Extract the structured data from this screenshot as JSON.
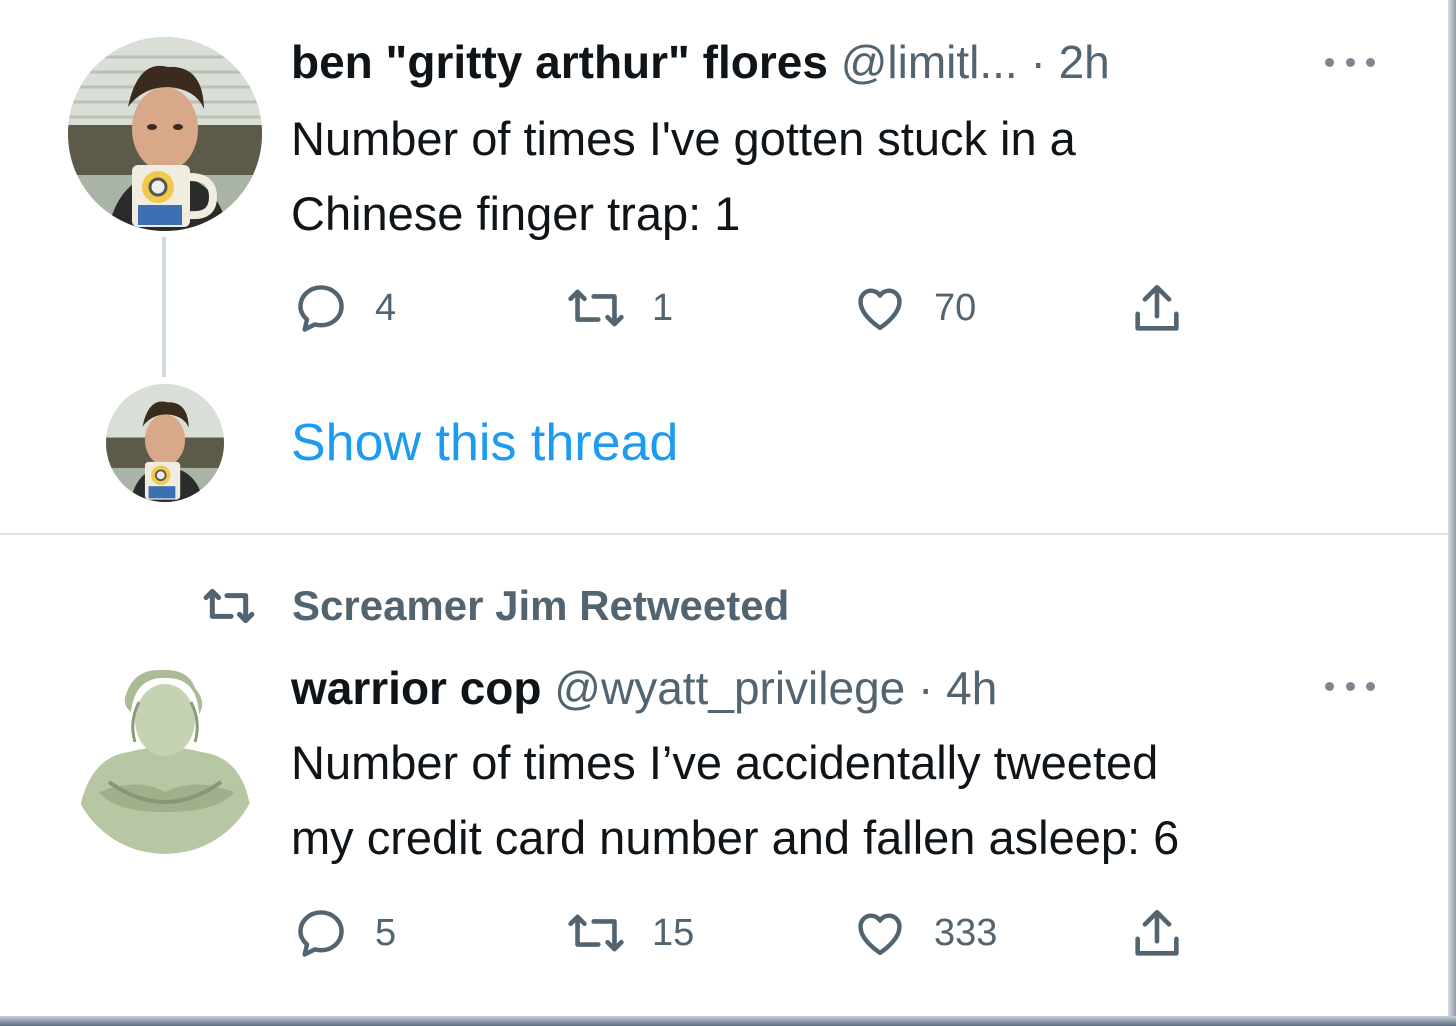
{
  "tweets": [
    {
      "display_name": "ben \"gritty arthur\" flores",
      "handle": "@limitl...",
      "separator": "·",
      "time": "2h",
      "text": "Number of times I've gotten stuck in a\nChinese finger trap: 1",
      "replies": "4",
      "retweets": "1",
      "likes": "70",
      "show_thread_label": "Show this thread"
    },
    {
      "retweet_context": "Screamer Jim Retweeted",
      "display_name": "warrior cop",
      "handle": "@wyatt_privilege",
      "separator": "·",
      "time": "4h",
      "text": "Number of times I’ve accidentally tweeted\nmy credit card number and fallen asleep: 6",
      "replies": "5",
      "retweets": "15",
      "likes": "333"
    }
  ],
  "colors": {
    "link": "#1d9bf0",
    "secondary_text": "#536471",
    "primary_text": "#0f1419"
  },
  "icons": [
    "reply-icon",
    "retweet-icon",
    "like-icon",
    "share-icon",
    "more-icon"
  ]
}
